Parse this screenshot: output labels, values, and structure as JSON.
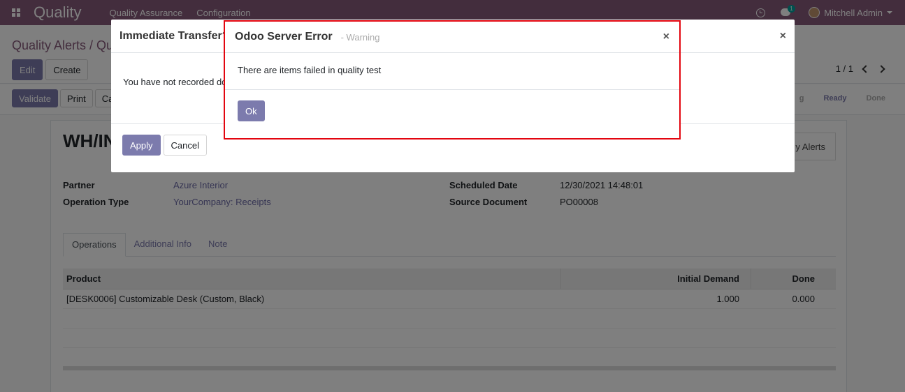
{
  "navbar": {
    "brand": "Quality",
    "menu": [
      "Quality Assurance",
      "Configuration"
    ],
    "chat_count": "1",
    "user_name": "Mitchell Admin"
  },
  "control_panel": {
    "breadcrumb": "Quality Alerts / Qu",
    "edit_label": "Edit",
    "create_label": "Create",
    "pager": "1 / 1"
  },
  "statusbar": {
    "buttons": [
      "Validate",
      "Print",
      "Ca"
    ],
    "stages": [
      "g",
      "Ready",
      "Done"
    ]
  },
  "form": {
    "record_name": "WH/IN",
    "smart_button": "y Alerts",
    "fields_left": [
      {
        "label": "Partner",
        "value": "Azure Interior"
      },
      {
        "label": "Operation Type",
        "value": "YourCompany: Receipts"
      }
    ],
    "fields_right": [
      {
        "label": "Scheduled Date",
        "value": "12/30/2021 14:48:01"
      },
      {
        "label": "Source Document",
        "value": "PO00008"
      }
    ],
    "tabs": [
      "Operations",
      "Additional Info",
      "Note"
    ],
    "table": {
      "headers": [
        "Product",
        "Initial Demand",
        "Done"
      ],
      "rows": [
        [
          "[DESK0006] Customizable Desk (Custom, Black)",
          "1.000",
          "0.000"
        ]
      ]
    }
  },
  "transfer_dialog": {
    "title": "Immediate Transfer?",
    "body": "You have not recorded do",
    "apply_label": "Apply",
    "cancel_label": "Cancel",
    "close": "×"
  },
  "error_dialog": {
    "title": "Odoo Server Error",
    "subtitle": "- Warning",
    "message": "There are items failed in quality test",
    "ok_label": "Ok",
    "close": "×"
  },
  "colors": {
    "navbar": "#875a7b",
    "primary_button": "#7c7bad",
    "highlight": "#e3050f"
  }
}
